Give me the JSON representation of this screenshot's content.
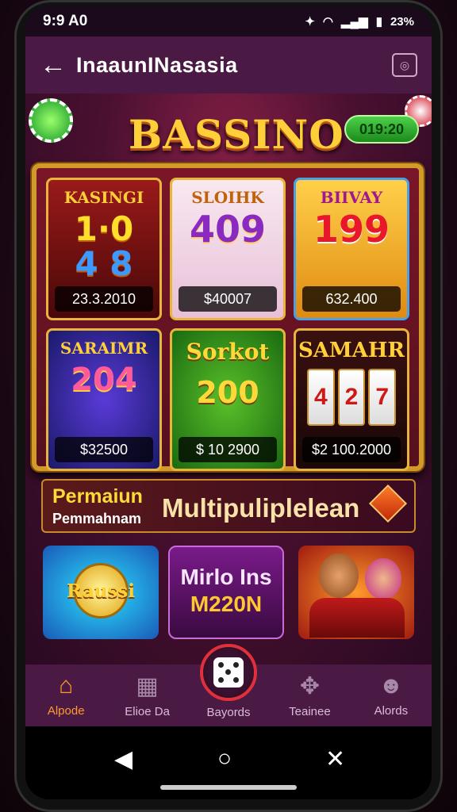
{
  "status": {
    "time": "9:9 A0",
    "battery_text": "23%"
  },
  "appbar": {
    "title": "InaaunINasasia"
  },
  "header": {
    "logo": "BASSINO",
    "timer": "019:20"
  },
  "games": [
    {
      "title": "KASINGI",
      "line1": "1·0",
      "line2": "4 8",
      "price": "23.3.2010"
    },
    {
      "title": "SLOIHK",
      "number": "409",
      "price": "$40007"
    },
    {
      "title": "BIIVAY",
      "number": "199",
      "price": "632.400"
    },
    {
      "title": "SARAIMR",
      "number": "204",
      "price": "$32500"
    },
    {
      "title": "Sorkot",
      "number": "200",
      "price": "$ 10 2900"
    },
    {
      "title": "SAMAHR",
      "reels": [
        "4",
        "2",
        "7"
      ],
      "price": "$2 100.2000"
    }
  ],
  "banner": {
    "line1": "Permaiun",
    "line2": "Pemmahnam",
    "big": "Multipuliplelean"
  },
  "tiles": [
    {
      "text": "Raussi"
    },
    {
      "line1": "Mirlo Ins",
      "line2": "M220N"
    },
    {
      "text": ""
    }
  ],
  "nav": {
    "items": [
      {
        "label": "Alpode",
        "icon": "home-icon",
        "active": true
      },
      {
        "label": "Elioe Da",
        "icon": "house-icon",
        "active": false
      },
      {
        "label": "Bayords",
        "icon": "dice-icon",
        "active": false
      },
      {
        "label": "Teainee",
        "icon": "puzzle-icon",
        "active": false
      },
      {
        "label": "Alords",
        "icon": "profile-icon",
        "active": false
      }
    ]
  },
  "colors": {
    "accent": "#ff9a2a",
    "appbar": "#4a1a45",
    "gold": "#ffcf3a"
  }
}
